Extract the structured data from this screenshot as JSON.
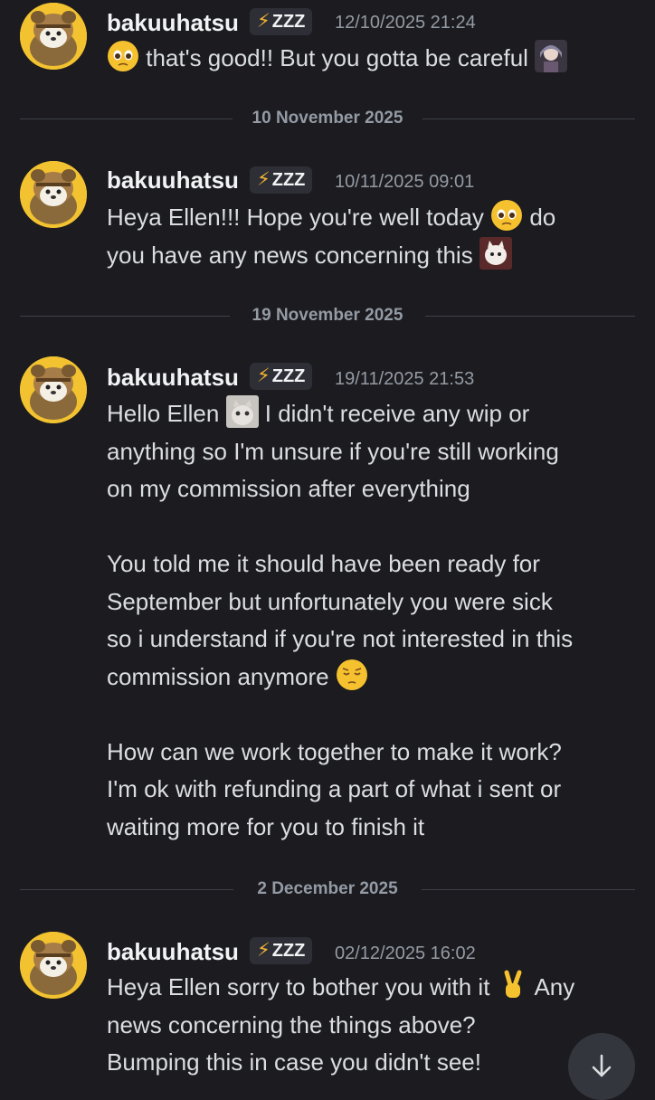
{
  "messages": [
    {
      "username": "bakuuhatsu",
      "badge": "ZZZ",
      "timestamp": "12/10/2025 21:24",
      "lines": [
        "that's good!! But you gotta be careful"
      ]
    },
    {
      "username": "bakuuhatsu",
      "badge": "ZZZ",
      "timestamp": "10/11/2025 09:01",
      "lines": [
        "Heya Ellen!!! Hope you're well today",
        "do",
        "you have any news concerning this"
      ]
    },
    {
      "username": "bakuuhatsu",
      "badge": "ZZZ",
      "timestamp": "19/11/2025 21:53",
      "lines": [
        "Hello Ellen",
        "I didn't receive any wip or",
        "anything so I'm unsure if you're still working",
        "on my commission after everything",
        "You told me it should have been ready for",
        "September but unfortunately you were sick",
        "so i understand if you're not interested in this",
        "commission anymore",
        "How can we work together to make it work?",
        "I'm ok with refunding a part of what i sent or",
        "waiting more for you to finish it"
      ]
    },
    {
      "username": "bakuuhatsu",
      "badge": "ZZZ",
      "timestamp": "02/12/2025 16:02",
      "lines": [
        "Heya Ellen sorry to bother you with it",
        "Any",
        "news concerning the things above?",
        "Bumping this in case you didn't see!"
      ]
    }
  ],
  "dividers": [
    "10 November 2025",
    "19 November 2025",
    "2 December 2025"
  ],
  "icons": {
    "badge": "lightning-bolt-icon",
    "scroll": "arrow-down-icon"
  },
  "colors": {
    "background": "#1b1b20",
    "username": "#f2f3f5",
    "text": "#dbdee1",
    "muted": "#949ba4",
    "bolt": "#f0b232",
    "avatar": "#f2c230"
  }
}
